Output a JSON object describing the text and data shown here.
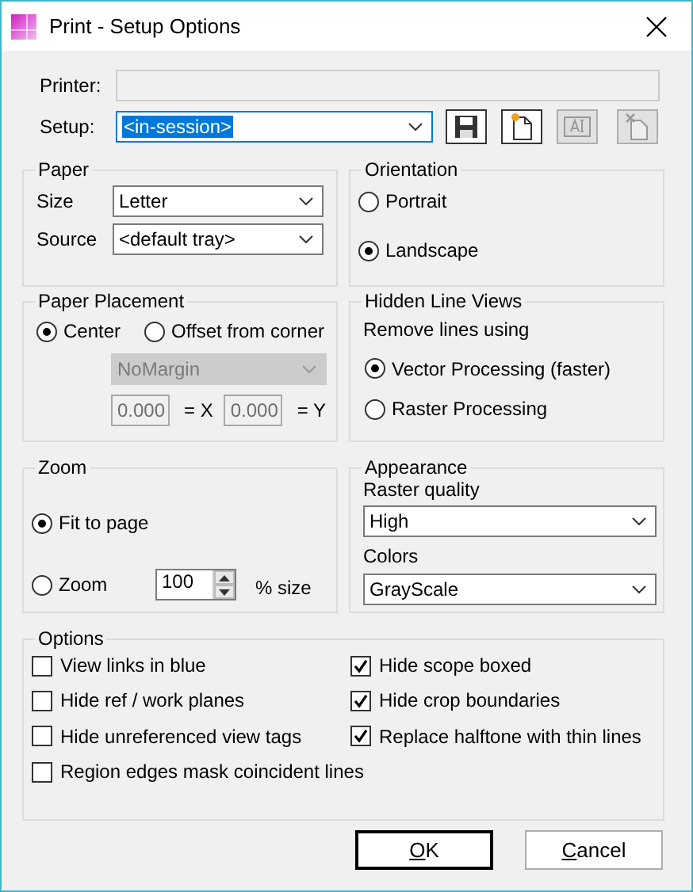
{
  "window": {
    "title": "Print - Setup Options"
  },
  "printer": {
    "label": "Printer:",
    "disabled": true
  },
  "setup": {
    "label": "Setup:",
    "value": "<in-session>",
    "focused": true,
    "tools": [
      {
        "kind": "save",
        "disabled": false
      },
      {
        "kind": "new",
        "disabled": false
      },
      {
        "kind": "rename",
        "disabled": true
      },
      {
        "kind": "delete",
        "disabled": true
      }
    ]
  },
  "paper": {
    "title": "Paper",
    "fields": [
      {
        "label": "Size",
        "value": "Letter"
      },
      {
        "label": "Source",
        "value": "<default tray>"
      }
    ]
  },
  "orientation": {
    "title": "Orientation",
    "options": [
      {
        "label": "Portrait",
        "selected": false
      },
      {
        "label": "Landscape",
        "selected": true
      }
    ]
  },
  "paper_placement": {
    "title": "Paper Placement",
    "options": [
      {
        "label": "Center",
        "selected": true
      },
      {
        "label": "Offset from corner",
        "selected": false
      }
    ],
    "margin": {
      "value": "NoMargin",
      "disabled": true
    },
    "offsets": [
      {
        "value": "0.000",
        "suffix": "= X",
        "disabled": true
      },
      {
        "value": "0.000",
        "suffix": "= Y",
        "disabled": true
      }
    ]
  },
  "hidden_line_views": {
    "title": "Hidden Line Views",
    "caption": "Remove lines using",
    "options": [
      {
        "label": "Vector Processing (faster)",
        "selected": true
      },
      {
        "label": "Raster Processing",
        "selected": false
      }
    ]
  },
  "zoom": {
    "title": "Zoom",
    "options": [
      {
        "label": "Fit to page",
        "selected": true
      },
      {
        "label": "Zoom",
        "selected": false
      }
    ],
    "spin_value": "100",
    "unit": "% size"
  },
  "appearance": {
    "title": "Appearance",
    "fields": [
      {
        "label": "Raster quality",
        "value": "High"
      },
      {
        "label": "Colors",
        "value": "GrayScale"
      }
    ]
  },
  "options": {
    "title": "Options",
    "columns": [
      [
        {
          "label": "View links in blue",
          "checked": false
        },
        {
          "label": "Hide ref / work planes",
          "checked": false
        },
        {
          "label": "Hide unreferenced view tags",
          "checked": false
        },
        {
          "label": "Region edges mask coincident lines",
          "checked": false
        }
      ],
      [
        {
          "label": "Hide scope boxed",
          "checked": true
        },
        {
          "label": "Hide crop boundaries",
          "checked": true
        },
        {
          "label": "Replace halftone with thin lines",
          "checked": true
        }
      ]
    ]
  },
  "buttons": [
    {
      "label": "OK",
      "default": true
    },
    {
      "label": "Cancel",
      "default": false
    }
  ]
}
